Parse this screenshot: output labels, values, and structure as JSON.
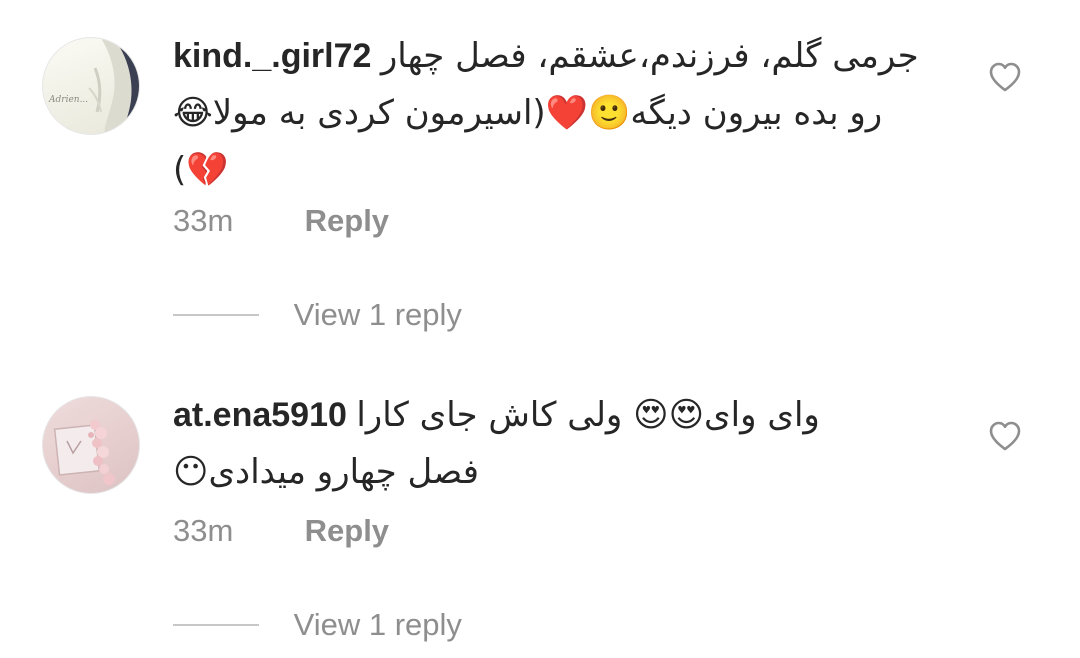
{
  "comments": [
    {
      "username": "kind._.girl72",
      "lines": [
        "جرمی گلم، فرزندم،عشقم، فصل چهار",
        "رو بده بیرون دیگه🙂❤️(اسیرمون کردی به مولا😂",
        "💔)"
      ],
      "time": "33m",
      "reply_label": "Reply",
      "view_replies_label": "View 1 reply",
      "avatar_text": "Adrien..."
    },
    {
      "username": "at.ena5910",
      "lines": [
        "وای وای😍😍 ولی کاش جای  کارا",
        "فصل چهارو میدادی😶"
      ],
      "time": "33m",
      "reply_label": "Reply",
      "view_replies_label": "View 1 reply"
    }
  ],
  "colors": {
    "text": "#262626",
    "muted": "#8e8e8e",
    "heart": "#8e8e8e"
  },
  "icons": {
    "like": "heart-outline-icon"
  }
}
